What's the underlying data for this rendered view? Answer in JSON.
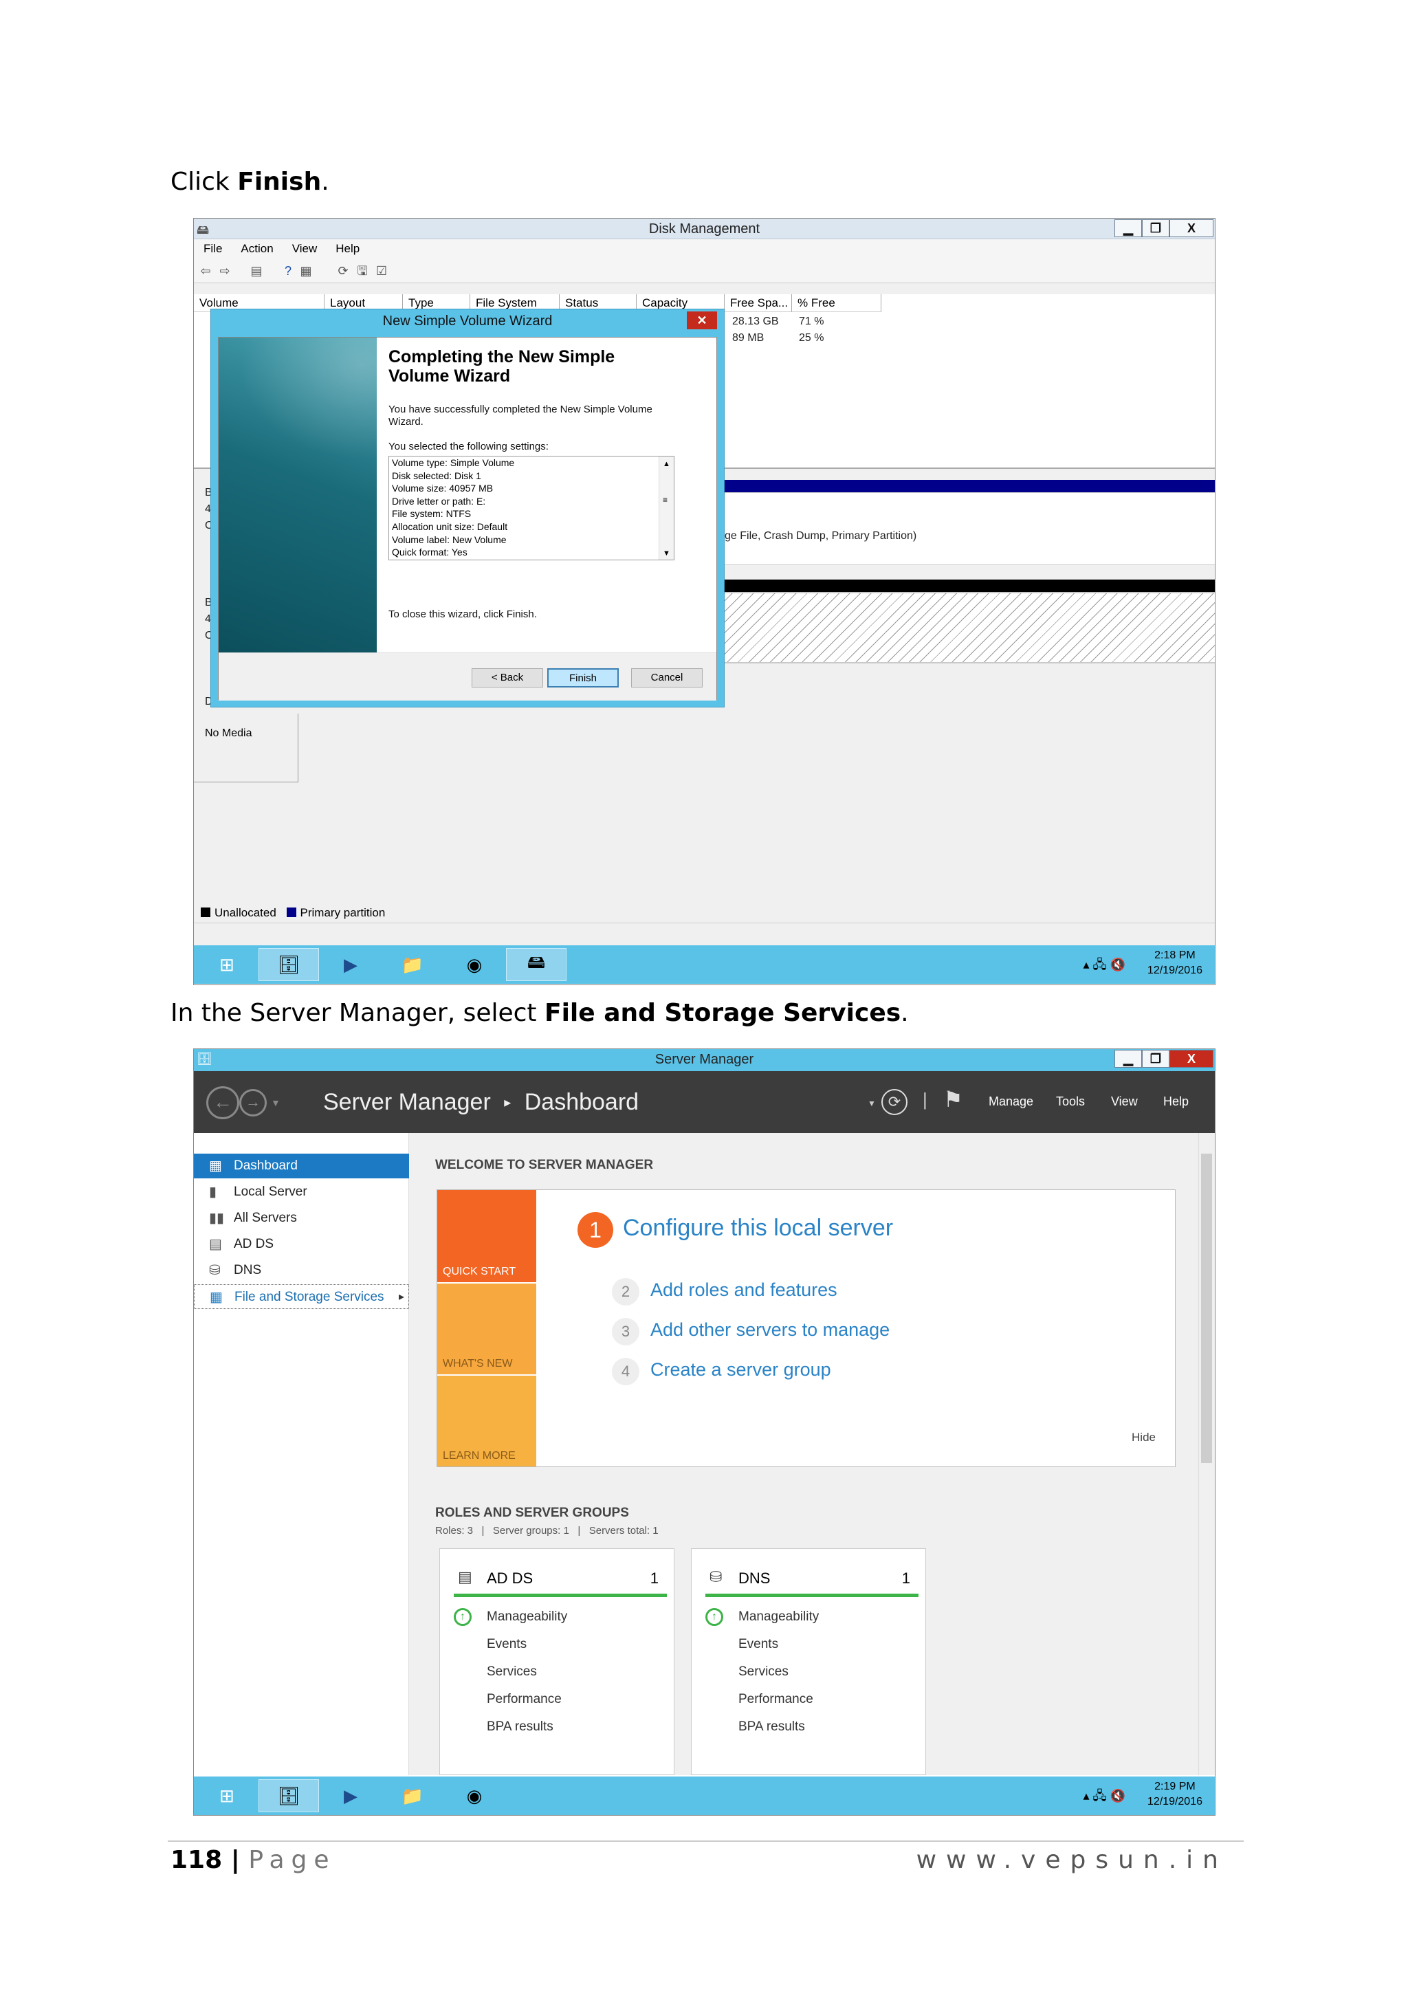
{
  "instruction1": {
    "prefix": "Click ",
    "bold": "Finish",
    "suffix": "."
  },
  "instruction2": {
    "prefix": "In the Server Manager, select ",
    "bold": "File and Storage Services",
    "suffix": "."
  },
  "disk_mgmt": {
    "title": "Disk Management",
    "window_buttons": {
      "minimize": "▁",
      "restore": "❐",
      "close": "X"
    },
    "menu": [
      "File",
      "Action",
      "View",
      "Help"
    ],
    "columns": [
      "Volume",
      "Layout",
      "Type",
      "File System",
      "Status",
      "Capacity",
      "Free Spa...",
      "% Free"
    ],
    "rows": [
      {
        "free": "28.13 GB",
        "pct": "71 %"
      },
      {
        "free": "89 MB",
        "pct": "25 %"
      }
    ],
    "partition_text": "ge File, Crash Dump, Primary Partition)",
    "left_labels": [
      "B",
      "4",
      "O",
      "B",
      "4",
      "O",
      "D"
    ],
    "no_media": "No Media",
    "legend": {
      "unallocated": "Unallocated",
      "primary": "Primary partition"
    },
    "colors": {
      "primary": "#00008b",
      "unallocated": "#000000"
    }
  },
  "wizard": {
    "title": "New Simple Volume Wizard",
    "close": "✕",
    "heading": "Completing the New Simple Volume Wizard",
    "success": "You have successfully completed the New Simple Volume Wizard.",
    "settings_label": "You selected the following settings:",
    "settings": [
      "Volume type: Simple Volume",
      "Disk selected: Disk 1",
      "Volume size: 40957 MB",
      "Drive letter or path: E:",
      "File system: NTFS",
      "Allocation unit size: Default",
      "Volume label: New Volume",
      "Quick format: Yes"
    ],
    "close_text": "To close this wizard, click Finish.",
    "buttons": {
      "back": "< Back",
      "finish": "Finish",
      "cancel": "Cancel"
    }
  },
  "taskbar1": {
    "time": "2:18 PM",
    "date": "12/19/2016"
  },
  "server_manager": {
    "title": "Server Manager",
    "window_buttons": {
      "minimize": "▁",
      "restore": "❐",
      "close": "X"
    },
    "breadcrumb": {
      "app": "Server Manager",
      "sep": "▸",
      "page": "Dashboard"
    },
    "header_menu": [
      "Manage",
      "Tools",
      "View",
      "Help"
    ],
    "nav": [
      {
        "label": "Dashboard",
        "icon": "dashboard-icon",
        "glyph": "▦"
      },
      {
        "label": "Local Server",
        "icon": "server-icon",
        "glyph": "▮"
      },
      {
        "label": "All Servers",
        "icon": "servers-icon",
        "glyph": "▮▮"
      },
      {
        "label": "AD DS",
        "icon": "adds-icon",
        "glyph": "▤"
      },
      {
        "label": "DNS",
        "icon": "dns-icon",
        "glyph": "⛁"
      },
      {
        "label": "File and Storage Services",
        "icon": "storage-icon",
        "glyph": "▦",
        "arrow": "▸"
      }
    ],
    "welcome": "WELCOME TO SERVER MANAGER",
    "tiles": [
      "QUICK START",
      "WHAT'S NEW",
      "LEARN MORE"
    ],
    "steps": [
      {
        "n": "1",
        "label": "Configure this local server"
      },
      {
        "n": "2",
        "label": "Add roles and features"
      },
      {
        "n": "3",
        "label": "Add other servers to manage"
      },
      {
        "n": "4",
        "label": "Create a server group"
      }
    ],
    "hide": "Hide",
    "roles_heading": "ROLES AND SERVER GROUPS",
    "roles_summary": "Roles: 3   |   Server groups: 1   |   Servers total: 1",
    "cards": [
      {
        "name": "AD DS",
        "count": "1",
        "rows": [
          "Manageability",
          "Events",
          "Services",
          "Performance",
          "BPA results"
        ]
      },
      {
        "name": "DNS",
        "count": "1",
        "rows": [
          "Manageability",
          "Events",
          "Services",
          "Performance",
          "BPA results"
        ]
      }
    ]
  },
  "taskbar2": {
    "time": "2:19 PM",
    "date": "12/19/2016"
  },
  "footer": {
    "page": "118",
    "sep": " | ",
    "page_word": "Page",
    "url": "www.vepsun.in"
  }
}
